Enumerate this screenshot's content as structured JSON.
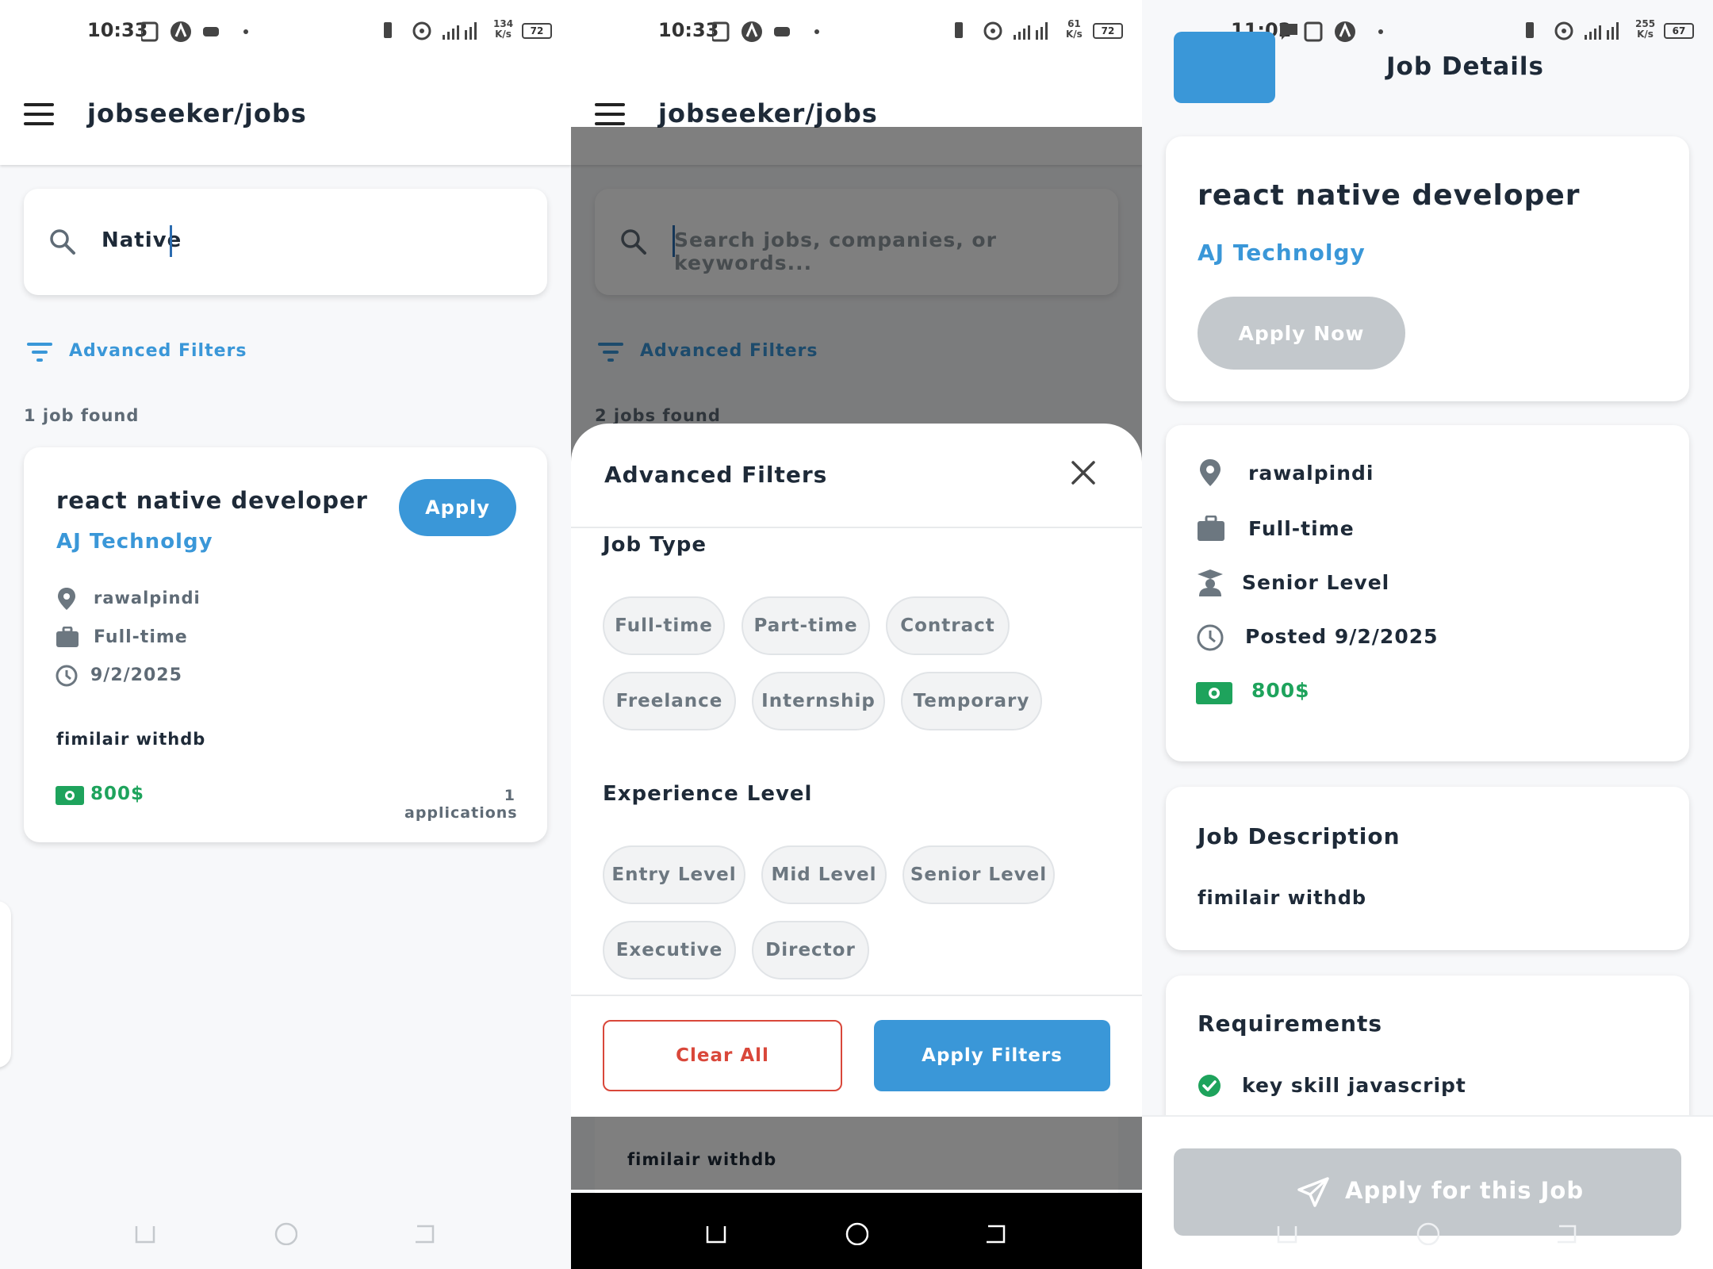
{
  "status_bars": [
    {
      "time": "10:33",
      "battery": "72",
      "speed_top": "134",
      "speed_bottom": "K/s"
    },
    {
      "time": "10:33",
      "battery": "72",
      "speed_top": "61",
      "speed_bottom": "K/s"
    },
    {
      "time": "11:02",
      "battery": "67",
      "speed_top": "255",
      "speed_bottom": "K/s"
    }
  ],
  "search_screen": {
    "title": "jobseeker/jobs",
    "search_value": "Native",
    "advanced_filters": "Advanced Filters",
    "result_count": "1 job found",
    "job": {
      "title": "react native developer",
      "company": "AJ Technolgy",
      "apply": "Apply",
      "location": "rawalpindi",
      "type": "Full-time",
      "date": "9/2/2025",
      "description": "fimilair withdb",
      "salary": "800$",
      "applications": "1 applications"
    }
  },
  "filter_screen": {
    "title": "jobseeker/jobs",
    "search_placeholder": "Search jobs, companies, or keywords...",
    "advanced_filters": "Advanced Filters",
    "result_count": "2 jobs found",
    "sheet": {
      "title": "Advanced Filters",
      "job_type_label": "Job Type",
      "job_types": [
        "Full-time",
        "Part-time",
        "Contract",
        "Freelance",
        "Internship",
        "Temporary"
      ],
      "experience_label": "Experience Level",
      "experience_levels": [
        "Entry Level",
        "Mid Level",
        "Senior Level",
        "Executive",
        "Director"
      ],
      "clear_all": "Clear All",
      "apply_filters": "Apply Filters"
    },
    "behind_description": "fimilair withdb"
  },
  "detail_screen": {
    "header": "Job Details",
    "title": "react native developer",
    "company": "AJ Technolgy",
    "apply_now": "Apply Now",
    "location": "rawalpindi",
    "type": "Full-time",
    "level": "Senior Level",
    "posted": "Posted 9/2/2025",
    "salary": "800$",
    "description_label": "Job Description",
    "description": "fimilair withdb",
    "requirements_label": "Requirements",
    "requirement_1": "key skill javascript",
    "apply_for_job": "Apply for this Job"
  },
  "colors": {
    "accent": "#3a97d8",
    "danger": "#d9473a",
    "success": "#1ea35c",
    "disabled": "#c3c8cc",
    "text": "#1e2a38"
  }
}
